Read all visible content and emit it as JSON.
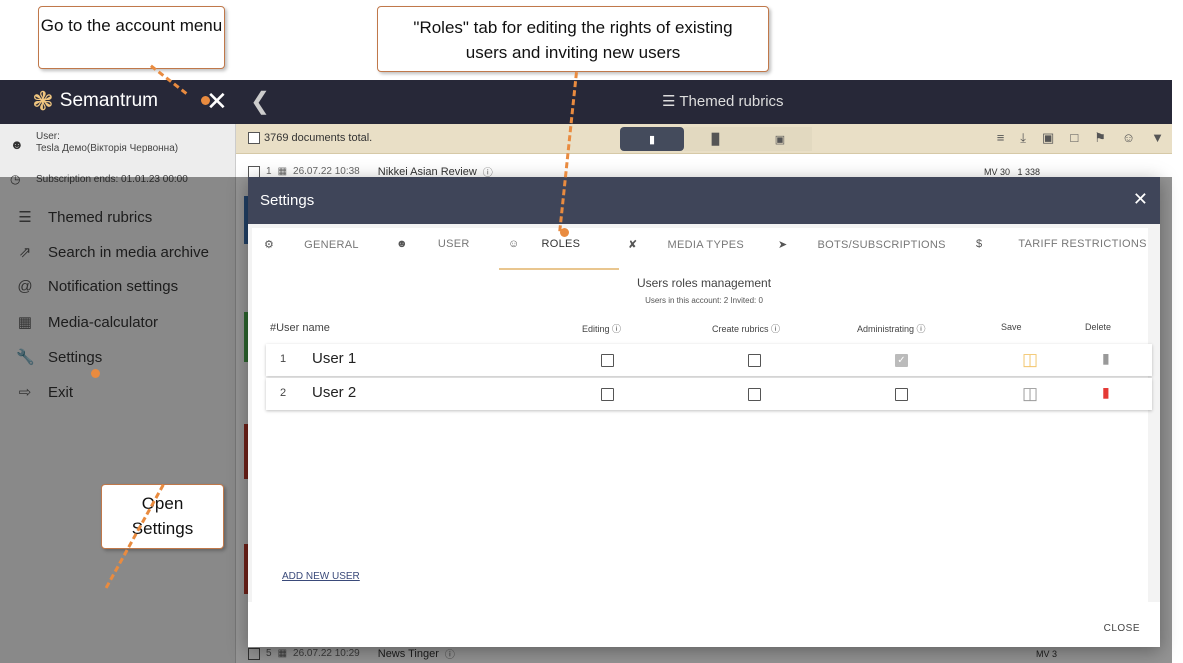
{
  "callouts": {
    "account": "Go to the account menu",
    "roles": "\"Roles\" tab for editing the rights of existing users and inviting new users",
    "settings": "Open Settings"
  },
  "app": {
    "logo": "Semantrum",
    "title": "Themed rubrics",
    "user_label": "User:",
    "user_name": "Tesla Демо(Вікторія Червонна)",
    "subscription": "Subscription ends: 01.01.23 00:00"
  },
  "sidebar": {
    "items": [
      {
        "label": "Themed rubrics",
        "icon": "list-icon"
      },
      {
        "label": "Search in media archive",
        "icon": "external-link-icon"
      },
      {
        "label": "Notification settings",
        "icon": "at-icon"
      },
      {
        "label": "Media-calculator",
        "icon": "calculator-icon"
      },
      {
        "label": "Settings",
        "icon": "wrench-icon"
      },
      {
        "label": "Exit",
        "icon": "exit-icon"
      }
    ]
  },
  "toolbar": {
    "docs_total": "3769 documents total."
  },
  "rows": [
    {
      "num": "1",
      "date": "26.07.22 10:38",
      "source": "Nikkei Asian Review",
      "mv": "MV 30",
      "reach": "1 338"
    },
    {
      "num": "5",
      "date": "26.07.22 10:29",
      "source": "News Tinger",
      "mv": "MV 3"
    }
  ],
  "modal": {
    "title": "Settings",
    "tabs": [
      "GENERAL",
      "USER",
      "ROLES",
      "MEDIA TYPES",
      "BOTS/SUBSCRIPTIONS",
      "TARIFF RESTRICTIONS"
    ],
    "roles_title": "Users roles management",
    "roles_sub": "Users in this account: 2   Invited: 0",
    "headers": {
      "name": "#User name",
      "editing": "Editing",
      "create": "Create rubrics",
      "admin": "Administrating",
      "save": "Save",
      "delete": "Delete"
    },
    "users": [
      {
        "num": "1",
        "name": "User 1",
        "editing": false,
        "create": false,
        "admin": true
      },
      {
        "num": "2",
        "name": "User 2",
        "editing": false,
        "create": false,
        "admin": false
      }
    ],
    "add_user": "ADD NEW USER",
    "close": "CLOSE"
  },
  "colors": {
    "header": "#272838",
    "modal_header": "#3f4559",
    "accent": "#e9c68f",
    "delete_active": "#e53935",
    "callout_line": "#e98b3f"
  }
}
